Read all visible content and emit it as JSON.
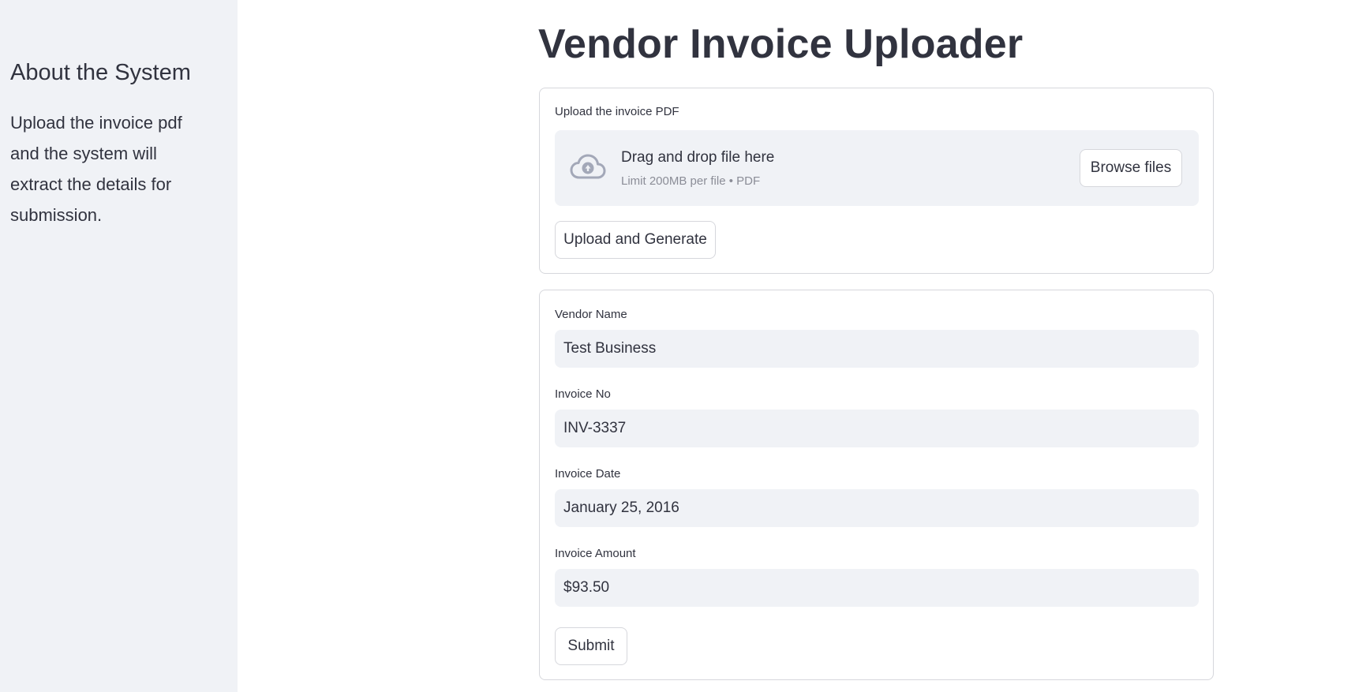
{
  "sidebar": {
    "title": "About the System",
    "description": "Upload the invoice pdf and the system will extract the details for submission."
  },
  "main": {
    "title": "Vendor Invoice Uploader"
  },
  "uploader": {
    "label": "Upload the invoice PDF",
    "drop_text": "Drag and drop file here",
    "limit_text": "Limit 200MB per file • PDF",
    "browse_label": "Browse files",
    "icon": "cloud-upload-icon",
    "generate_label": "Upload and Generate"
  },
  "form": {
    "vendor_name": {
      "label": "Vendor Name",
      "value": "Test Business"
    },
    "invoice_no": {
      "label": "Invoice No",
      "value": "INV-3337"
    },
    "invoice_date": {
      "label": "Invoice Date",
      "value": "January 25, 2016"
    },
    "invoice_amount": {
      "label": "Invoice Amount",
      "value": "$93.50"
    },
    "submit_label": "Submit"
  },
  "colors": {
    "sidebar_bg": "#f0f2f6",
    "text": "#31333f",
    "muted_text": "#8b8d97",
    "border": "#d6d7dc",
    "icon": "#a3a8b8"
  }
}
